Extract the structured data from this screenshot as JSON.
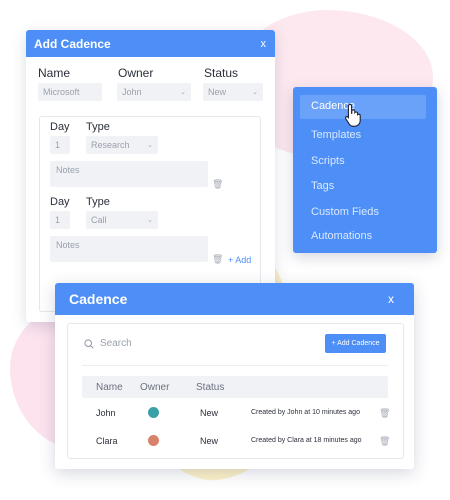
{
  "add_dialog": {
    "title": "Add Cadence",
    "close": "x",
    "labels": {
      "name": "Name",
      "owner": "Owner",
      "status": "Status"
    },
    "values": {
      "name": "Microsoft",
      "owner": "John",
      "status": "New"
    },
    "steps": [
      {
        "day_label": "Day",
        "type_label": "Type",
        "day": "1",
        "type": "Research",
        "notes_placeholder": "Notes"
      },
      {
        "day_label": "Day",
        "type_label": "Type",
        "day": "1",
        "type": "Call",
        "notes_placeholder": "Notes"
      }
    ],
    "add_link": "+ Add"
  },
  "menu": {
    "items": [
      {
        "label": "Cadence",
        "active": true
      },
      {
        "label": "Templates"
      },
      {
        "label": "Scripts"
      },
      {
        "label": "Tags"
      },
      {
        "label": "Custom Fieds"
      },
      {
        "label": "Automations"
      }
    ]
  },
  "cadence_dialog": {
    "title": "Cadence",
    "close": "x",
    "search_placeholder": "Search",
    "add_button": "+ Add Cadence",
    "columns": [
      "Name",
      "Owner",
      "Status"
    ],
    "rows": [
      {
        "name": "John",
        "status": "New",
        "created": "Created by John at 10 minutes ago",
        "avatar_color": "#3aa0a8"
      },
      {
        "name": "Clara",
        "status": "New",
        "created": "Created by Clara at 18 minutes ago",
        "avatar_color": "#d9826b"
      }
    ]
  },
  "colors": {
    "accent": "#4e8ff7",
    "menu_active": "#6aa2f9"
  }
}
